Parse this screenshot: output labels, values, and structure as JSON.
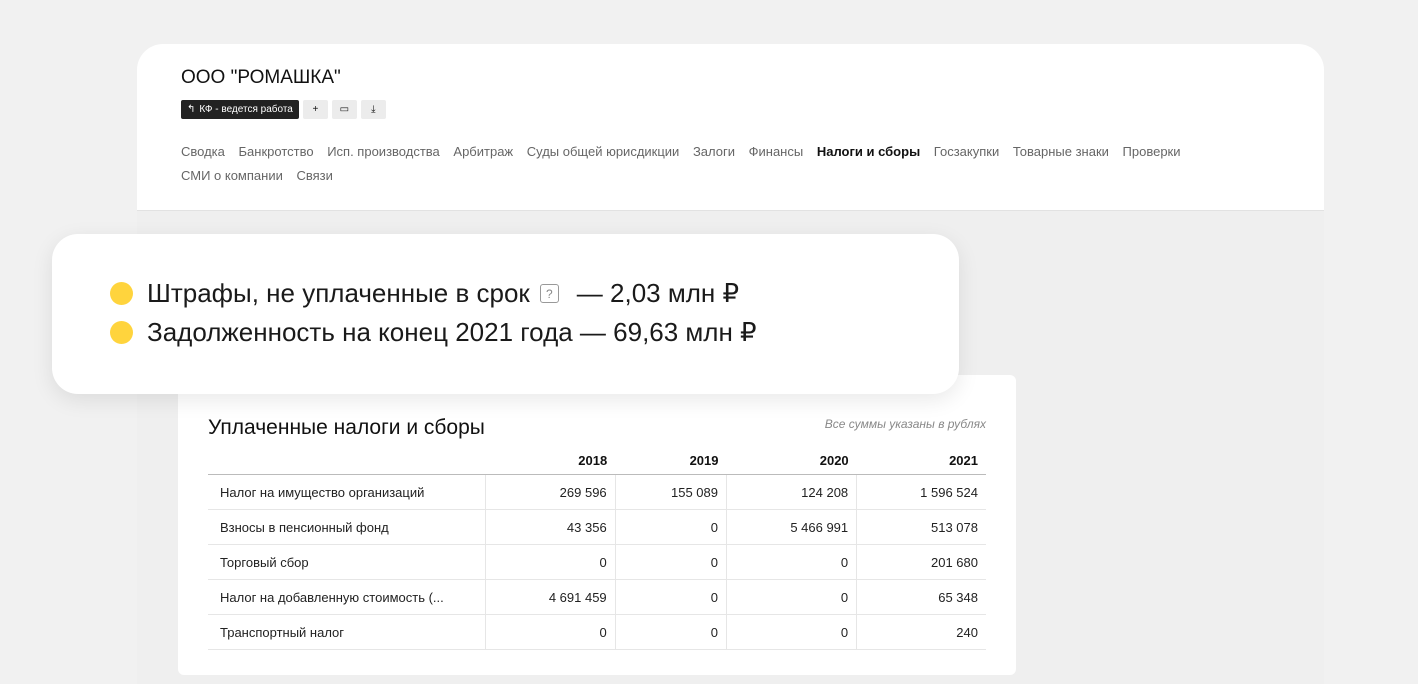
{
  "company": {
    "name": "ООО \"РОМАШКА\""
  },
  "toolbar": {
    "status_label": "КФ - ведется работа",
    "add_symbol": "+",
    "comment_symbol": "▭",
    "download_symbol": "⤓"
  },
  "nav": {
    "items": [
      "Сводка",
      "Банкротство",
      "Исп. производства",
      "Арбитраж",
      "Суды общей юрисдикции",
      "Залоги",
      "Финансы",
      "Налоги и сборы",
      "Госзакупки",
      "Товарные знаки",
      "Проверки",
      "СМИ о компании",
      "Связи"
    ],
    "active": "Налоги и сборы"
  },
  "highlights": {
    "fines_label": "Штрафы, не уплаченные в срок",
    "help_symbol": "?",
    "fines_value": "— 2,03 млн ₽",
    "debt_text": "Задолженность на конец 2021 года — 69,63 млн ₽",
    "dot_color": "#ffd43d"
  },
  "taxes": {
    "title": "Уплаченные налоги и сборы",
    "note": "Все суммы указаны в рублях",
    "years": [
      "2018",
      "2019",
      "2020",
      "2021"
    ],
    "rows": [
      {
        "name": "Налог на имущество организаций",
        "values": [
          "269 596",
          "155 089",
          "124 208",
          "1 596 524"
        ]
      },
      {
        "name": "Взносы в пенсионный фонд",
        "values": [
          "43 356",
          "0",
          "5 466 991",
          "513 078"
        ]
      },
      {
        "name": "Торговый сбор",
        "values": [
          "0",
          "0",
          "0",
          "201 680"
        ]
      },
      {
        "name": "Налог на добавленную стоимость (...",
        "values": [
          "4 691 459",
          "0",
          "0",
          "65 348"
        ]
      },
      {
        "name": "Транспортный налог",
        "values": [
          "0",
          "0",
          "0",
          "240"
        ]
      }
    ]
  }
}
